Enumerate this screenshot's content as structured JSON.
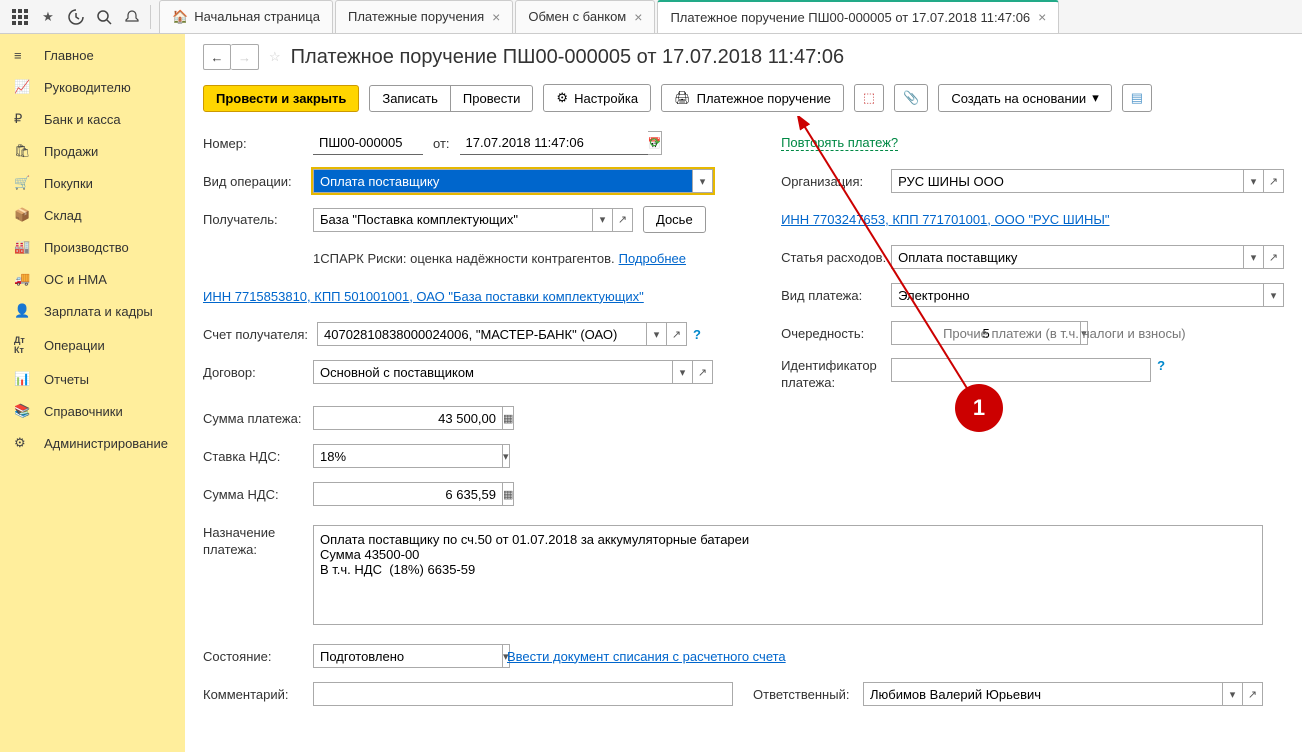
{
  "top_tabs": {
    "home": "Начальная страница",
    "t1": "Платежные поручения",
    "t2": "Обмен с банком",
    "active": "Платежное поручение ПШ00-000005 от 17.07.2018 11:47:06"
  },
  "sidebar": [
    "Главное",
    "Руководителю",
    "Банк и касса",
    "Продажи",
    "Покупки",
    "Склад",
    "Производство",
    "ОС и НМА",
    "Зарплата и кадры",
    "Операции",
    "Отчеты",
    "Справочники",
    "Администрирование"
  ],
  "title": "Платежное поручение ПШ00-000005 от 17.07.2018 11:47:06",
  "toolbar": {
    "main": "Провести и закрыть",
    "save": "Записать",
    "post": "Провести",
    "settings": "Настройка",
    "print": "Платежное поручение",
    "create_based": "Создать на основании"
  },
  "form": {
    "number_label": "Номер:",
    "number": "ПШ00-000005",
    "from": "от:",
    "date": "17.07.2018 11:47:06",
    "repeat": "Повторять платеж?",
    "op_type_label": "Вид операции:",
    "op_type": "Оплата поставщику",
    "org_label": "Организация:",
    "org": "РУС ШИНЫ ООО",
    "recipient_label": "Получатель:",
    "recipient": "База \"Поставка комплектующих\"",
    "dossier": "Досье",
    "org_link": "ИНН 7703247653, КПП 771701001, ООО \"РУС ШИНЫ\"",
    "spark": "1СПАРК Риски: оценка надёжности контрагентов.",
    "spark_more": "Подробнее",
    "expense_label": "Статья расходов:",
    "expense": "Оплата поставщику",
    "recipient_link": "ИНН 7715853810, КПП 501001001, ОАО \"База поставки комплектующих\"",
    "payment_type_label": "Вид платежа:",
    "payment_type": "Электронно",
    "account_label": "Счет получателя:",
    "account": "40702810838000024006, \"МАСТЕР-БАНК\" (ОАО)",
    "priority_label": "Очередность:",
    "priority": "5",
    "priority_desc": "Прочие платежи (в т.ч. налоги и взносы)",
    "contract_label": "Договор:",
    "contract": "Основной с поставщиком",
    "identifier_label": "Идентификатор платежа:",
    "sum_label": "Сумма платежа:",
    "sum": "43 500,00",
    "vat_rate_label": "Ставка НДС:",
    "vat_rate": "18%",
    "vat_sum_label": "Сумма НДС:",
    "vat_sum": "6 635,59",
    "purpose_label": "Назначение платежа:",
    "purpose": "Оплата поставщику по сч.50 от 01.07.2018 за аккумуляторные батареи\nСумма 43500-00\nВ т.ч. НДС  (18%) 6635-59",
    "state_label": "Состояние:",
    "state": "Подготовлено",
    "state_link": "Ввести документ списания с расчетного счета",
    "comment_label": "Комментарий:",
    "responsible_label": "Ответственный:",
    "responsible": "Любимов Валерий Юрьевич"
  },
  "annotation": "1"
}
